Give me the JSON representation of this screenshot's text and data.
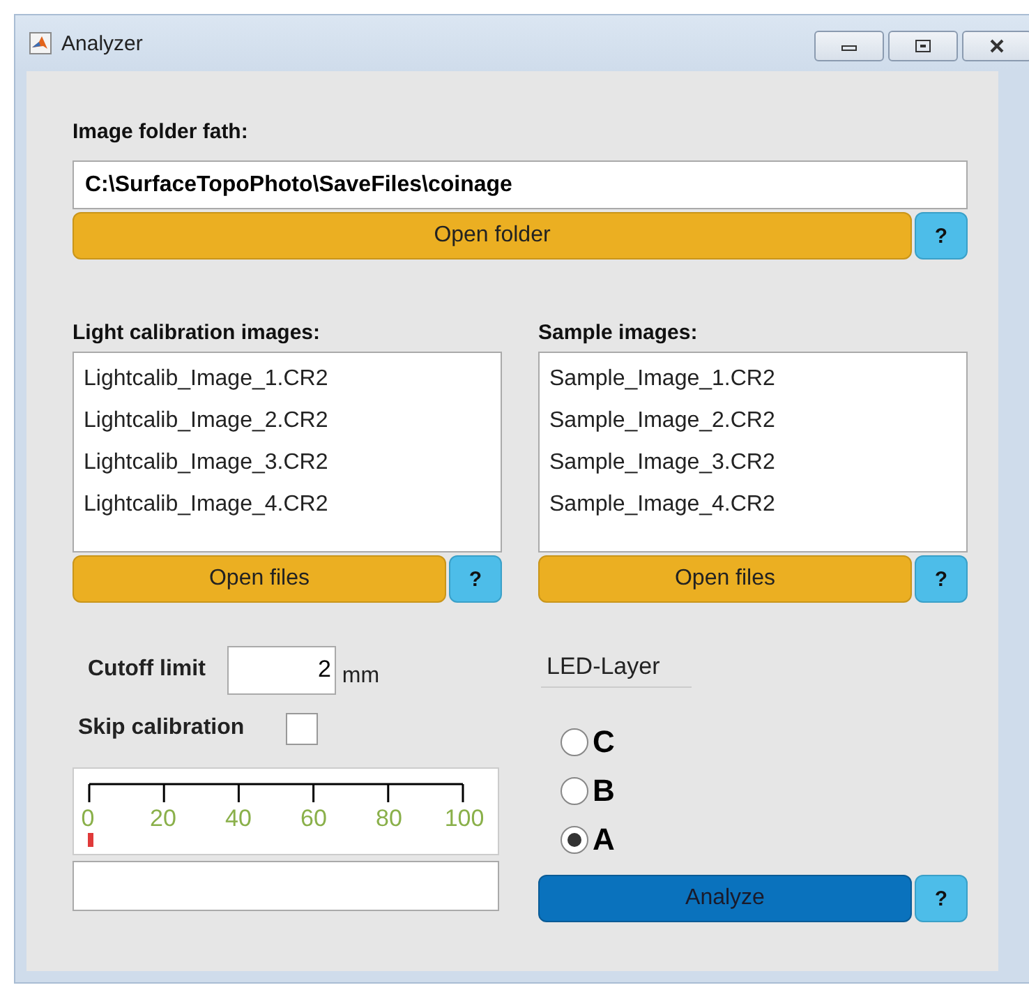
{
  "window": {
    "title": "Analyzer"
  },
  "folder": {
    "label": "Image folder fath:",
    "value": "C:\\SurfaceTopoPhoto\\SaveFiles\\coinage",
    "button": "Open folder",
    "help": "?"
  },
  "lists": [
    {
      "label": "Light calibration images:",
      "items": [
        "Lightcalib_Image_1.CR2",
        "Lightcalib_Image_2.CR2",
        "Lightcalib_Image_3.CR2",
        "Lightcalib_Image_4.CR2"
      ],
      "button": "Open files",
      "help": "?"
    },
    {
      "label": "Sample images:",
      "items": [
        "Sample_Image_1.CR2",
        "Sample_Image_2.CR2",
        "Sample_Image_3.CR2",
        "Sample_Image_4.CR2"
      ],
      "button": "Open files",
      "help": "?"
    }
  ],
  "cutoff": {
    "label": "Cutoff limit",
    "value": "2",
    "unit": "mm"
  },
  "skip_calibration": {
    "label": "Skip calibration",
    "checked": false
  },
  "gauge": {
    "ticks": [
      "0",
      "20",
      "40",
      "60",
      "80",
      "100"
    ],
    "level": 0
  },
  "led_layer": {
    "title": "LED-Layer",
    "options": [
      {
        "label": "C",
        "selected": false
      },
      {
        "label": "B",
        "selected": false
      },
      {
        "label": "A",
        "selected": true
      }
    ]
  },
  "analyze": {
    "button": "Analyze",
    "help": "?"
  }
}
